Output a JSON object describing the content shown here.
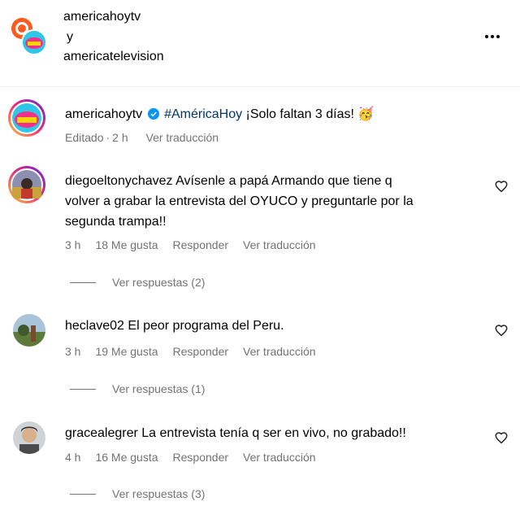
{
  "header": {
    "account1": "americahoytv",
    "connector": "y",
    "account2": "americatelevision",
    "more_label": "•••"
  },
  "post": {
    "username": "americahoytv",
    "hashtag": "#AméricaHoy",
    "caption": "¡Solo faltan 3 días!",
    "emoji": "🥳",
    "edited": "Editado",
    "time": "2 h",
    "translate": "Ver traducción"
  },
  "comments": [
    {
      "username": "diegoeltonychavez",
      "text_line1": "Avísenle a papá Armando que tiene q",
      "text_line2": "volver a grabar la entrevista del OYUCO y preguntarle por la",
      "text_line3": "segunda trampa!!",
      "time": "3 h",
      "likes": "18 Me gusta",
      "reply": "Responder",
      "translate": "Ver traducción",
      "replies": "Ver respuestas (2)"
    },
    {
      "username": "heclave02",
      "text_line1": "El peor programa del Peru.",
      "time": "3 h",
      "likes": "19 Me gusta",
      "reply": "Responder",
      "translate": "Ver traducción",
      "replies": "Ver respuestas (1)"
    },
    {
      "username": "gracealegrer",
      "text_line1": "La entrevista tenía q ser en vivo, no grabado!!",
      "time": "4 h",
      "likes": "16 Me gusta",
      "reply": "Responder",
      "translate": "Ver traducción",
      "replies": "Ver respuestas (3)"
    }
  ],
  "colors": {
    "link": "#00376b",
    "muted": "#737373",
    "verified": "#0095f6"
  },
  "icons": {
    "verified": "verified-badge-icon",
    "heart": "heart-outline-icon",
    "more": "more-options-icon"
  }
}
